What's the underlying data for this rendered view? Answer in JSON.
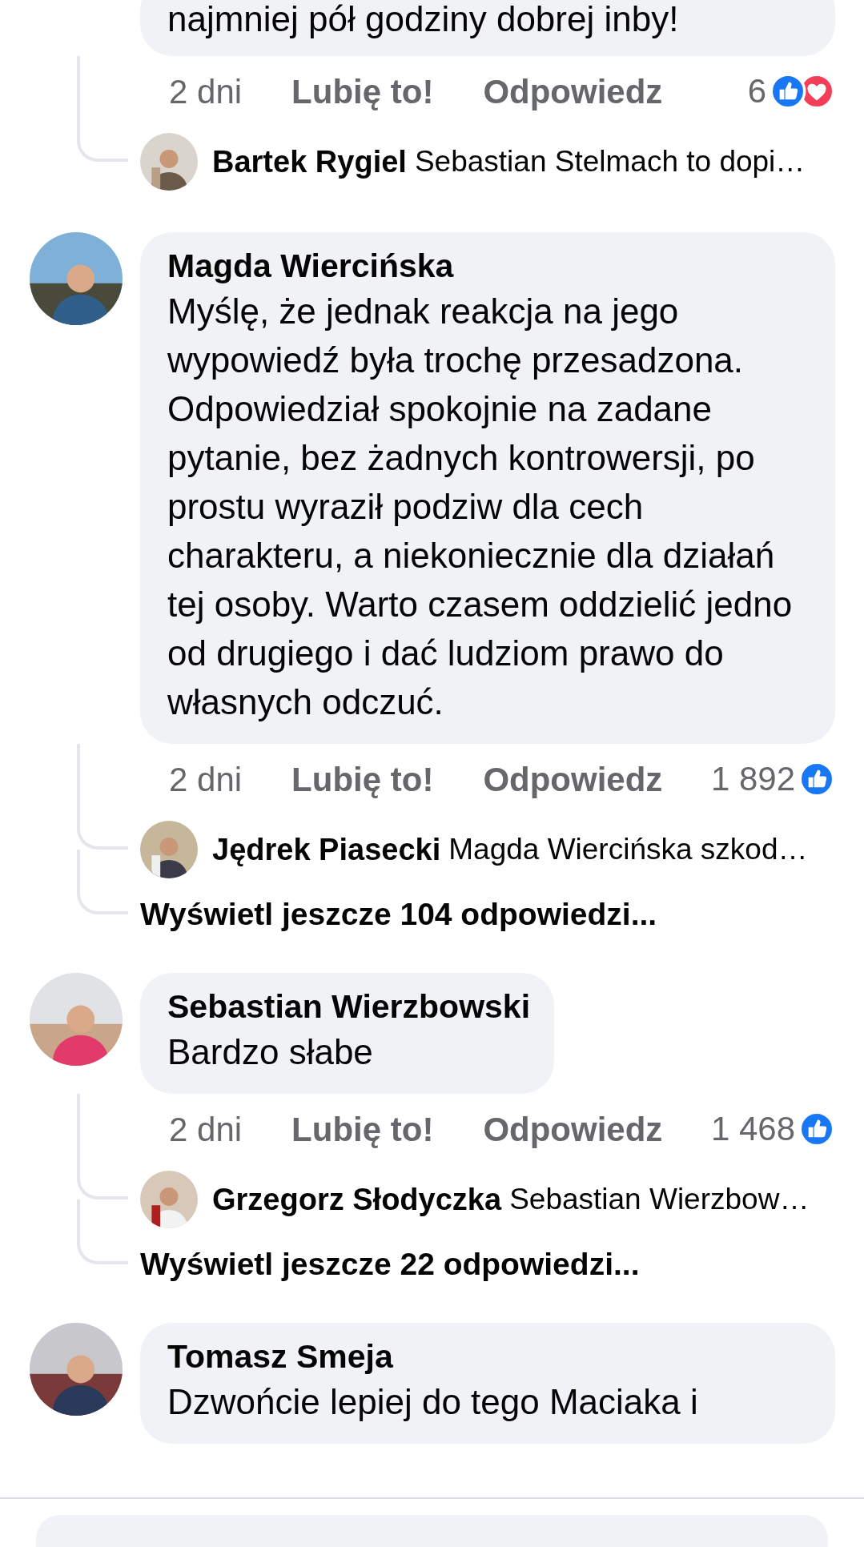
{
  "thread": [
    {
      "kind": "tail",
      "text": "najmniej pół godziny dobrej inby!",
      "time": "2 dni",
      "like_label": "Lubię to!",
      "reply_label": "Odpowiedz",
      "reaction_count": "6",
      "reactions": [
        {
          "kind": "like"
        },
        {
          "kind": "love"
        }
      ],
      "replies": [
        {
          "author": "Bartek Rygiel",
          "preview": "Sebastian Stelmach to dopi…"
        }
      ]
    },
    {
      "kind": "comment",
      "author": "Magda Wiercińska",
      "text": "Myślę, że jednak reakcja na jego wypowiedź była trochę przesadzona. Odpowiedział spokojnie na zadane pytanie, bez żadnych kontrowersji, po prostu wyraził podziw dla cech charakteru, a niekoniecznie dla działań tej osoby. Warto czasem oddzielić jedno od drugiego i dać ludziom prawo do własnych odczuć.",
      "time": "2 dni",
      "like_label": "Lubię to!",
      "reply_label": "Odpowiedz",
      "reaction_count": "1 892",
      "reactions": [
        {
          "kind": "like"
        }
      ],
      "replies": [
        {
          "author": "Jędrek Piasecki",
          "preview": "Magda Wiercińska szkod…"
        }
      ],
      "more_replies": "Wyświetl jeszcze 104 odpowiedzi..."
    },
    {
      "kind": "comment",
      "author": "Sebastian Wierzbowski",
      "text": "Bardzo słabe",
      "time": "2 dni",
      "like_label": "Lubię to!",
      "reply_label": "Odpowiedz",
      "reaction_count": "1 468",
      "reactions": [
        {
          "kind": "like"
        }
      ],
      "replies": [
        {
          "author": "Grzegorz Słodyczka",
          "preview": "Sebastian Wierzbow…"
        }
      ],
      "more_replies": "Wyświetl jeszcze 22 odpowiedzi..."
    },
    {
      "kind": "head",
      "author": "Tomasz Smeja",
      "text": "Dzwońcie lepiej do tego Maciaka i"
    }
  ]
}
